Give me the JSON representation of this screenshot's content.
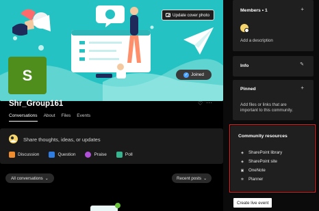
{
  "header": {
    "update_cover_label": "Update cover photo",
    "group_initial": "S",
    "joined_label": "Joined",
    "group_name": "Shr_Group161"
  },
  "tabs": [
    {
      "label": "Conversations",
      "active": true
    },
    {
      "label": "About",
      "active": false
    },
    {
      "label": "Files",
      "active": false
    },
    {
      "label": "Events",
      "active": false
    }
  ],
  "composer": {
    "prompt": "Share thoughts, ideas, or updates",
    "types": [
      {
        "label": "Discussion",
        "color": "#f08b2e"
      },
      {
        "label": "Question",
        "color": "#2f7de1"
      },
      {
        "label": "Praise",
        "color": "#b050d8"
      },
      {
        "label": "Poll",
        "color": "#38b38f"
      }
    ]
  },
  "feed": {
    "filter_label": "All conversations",
    "sort_label": "Recent posts"
  },
  "sidebar": {
    "members": {
      "title": "Members • 1",
      "add_description": "Add a description"
    },
    "info": {
      "title": "Info"
    },
    "pinned": {
      "title": "Pinned",
      "text_line1": "Add files or links that are",
      "text_line2": "important to this community."
    },
    "resources": {
      "title": "Community resources",
      "items": [
        {
          "label": "SharePoint library",
          "icon": "library-icon"
        },
        {
          "label": "SharePoint site",
          "icon": "sharepoint-icon"
        },
        {
          "label": "OneNote",
          "icon": "onenote-icon"
        },
        {
          "label": "Planner",
          "icon": "planner-icon"
        }
      ]
    },
    "create_live_event": "Create live event"
  },
  "colors": {
    "accent_blue": "#4aa3ff",
    "cover_teal": "#25c2c4",
    "avatar_green": "#4f8d1c",
    "highlight_red": "#e21e1e"
  }
}
